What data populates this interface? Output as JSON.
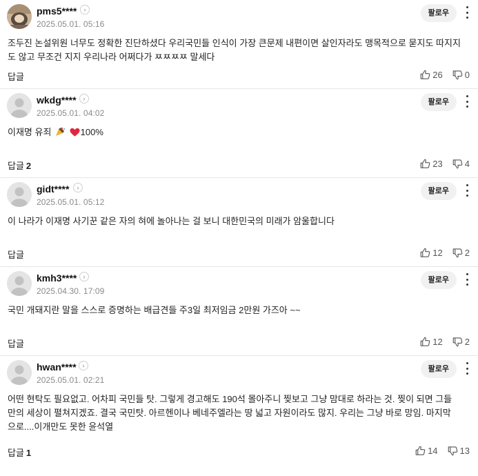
{
  "comments": [
    {
      "username": "pms5****",
      "date": "2025.05.01. 05:16",
      "follow_label": "팔로우",
      "content": "조두진 논설위원 너무도 정확한 진단하셨다 우리국민들 인식이 가장 큰문제 내편이면 살인자라도 맹목적으로 묻지도 따지지도 않고 무조건 지지 우리나라 어쩌다가 ㅉㅉㅉㅉ 말세다",
      "reply_label": "답글",
      "reply_count": "",
      "likes": "26",
      "dislikes": "0",
      "avatar": "photo"
    },
    {
      "username": "wkdg****",
      "date": "2025.05.01. 04:02",
      "follow_label": "팔로우",
      "content": "이재명 유죄",
      "content_suffix": "100%",
      "reply_label": "답글",
      "reply_count": "2",
      "likes": "23",
      "dislikes": "4",
      "avatar": "default"
    },
    {
      "username": "gidt****",
      "date": "2025.05.01. 05:12",
      "follow_label": "팔로우",
      "content": "이 나라가 이재명 사기꾼 같은 자의 혀에 놀아나는 걸 보니 대한민국의 미래가 암울합니다",
      "reply_label": "답글",
      "reply_count": "",
      "likes": "12",
      "dislikes": "2",
      "avatar": "default"
    },
    {
      "username": "kmh3****",
      "date": "2025.04.30. 17:09",
      "follow_label": "팔로우",
      "content": "국민 개돼지란 말을 스스로 증명하는 배급견들 주3일 최저임금 2만원 가즈아 ~~",
      "reply_label": "답글",
      "reply_count": "",
      "likes": "12",
      "dislikes": "2",
      "avatar": "default"
    },
    {
      "username": "hwan****",
      "date": "2025.05.01. 02:21",
      "follow_label": "팔로우",
      "content": "어떤 현탁도 필요없고. 어차피 국민들 탓. 그렇게 경고해도 190석 몰아주니 찢보고 그냥 맘대로 하라는 것. 찢이 되면 그들만의 세상이 펼쳐지겠죠. 결국 국민탓. 아르헨이나 베네주엘라는 땅 넓고 자원이라도 많지. 우리는 그냥 바로 망임. 마지막으로....이개만도 못한 윤석열",
      "reply_label": "답글",
      "reply_count": "1",
      "likes": "14",
      "dislikes": "13",
      "avatar": "default"
    }
  ],
  "icons": {
    "profile_arrow": "chevron-right-icon",
    "more": "more-vertical-icon",
    "like": "thumbs-up-icon",
    "dislike": "thumbs-down-icon",
    "emoji_1": "pencil-party-emoji",
    "emoji_2": "red-heart-emoji"
  },
  "colors": {
    "heart": "#e0263b",
    "follow_bg": "#f1f1f1",
    "date": "#8a8a8a"
  }
}
